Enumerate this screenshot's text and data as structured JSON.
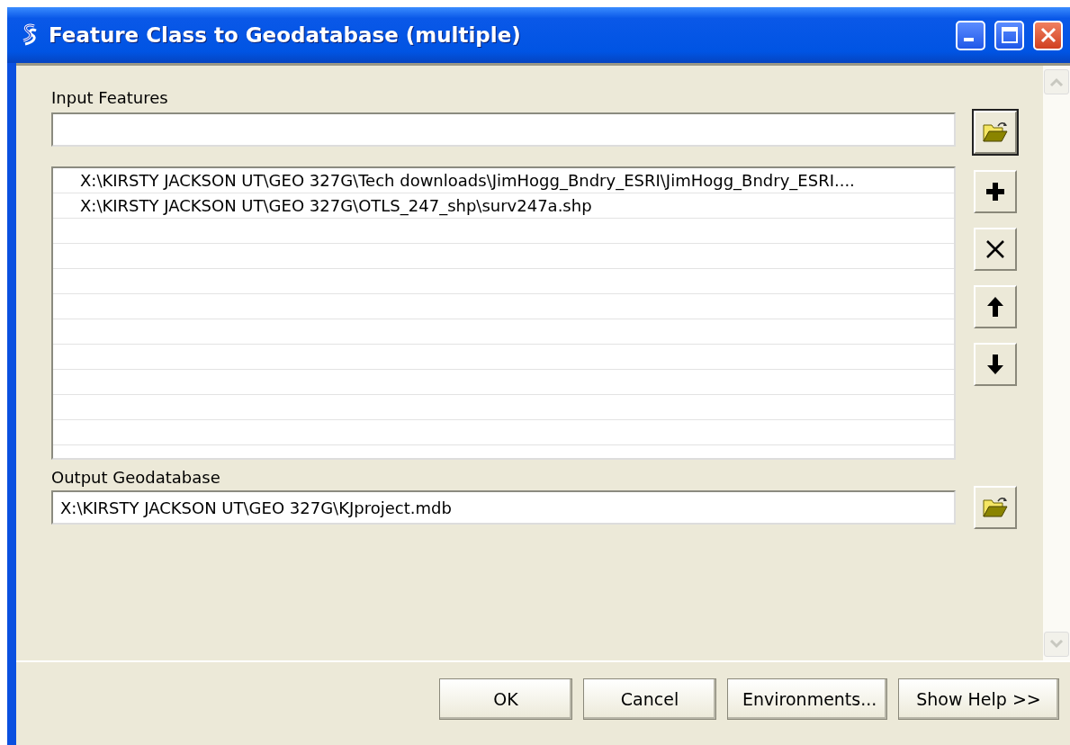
{
  "window": {
    "title": "Feature Class to Geodatabase (multiple)"
  },
  "input_features": {
    "label": "Input Features",
    "items": [
      {
        "text": "X:\\KIRSTY JACKSON UT\\GEO 327G\\Tech downloads\\JimHogg_Bndry_ESRI\\JimHogg_Bndry_ESRI...."
      },
      {
        "text": "X:\\KIRSTY JACKSON UT\\GEO 327G\\OTLS_247_shp\\surv247a.shp"
      }
    ]
  },
  "output_geodatabase": {
    "label": "Output Geodatabase",
    "value": "X:\\KIRSTY JACKSON UT\\GEO 327G\\KJproject.mdb"
  },
  "buttons": [
    "OK",
    "Cancel",
    "Environments...",
    "Show Help >>"
  ]
}
